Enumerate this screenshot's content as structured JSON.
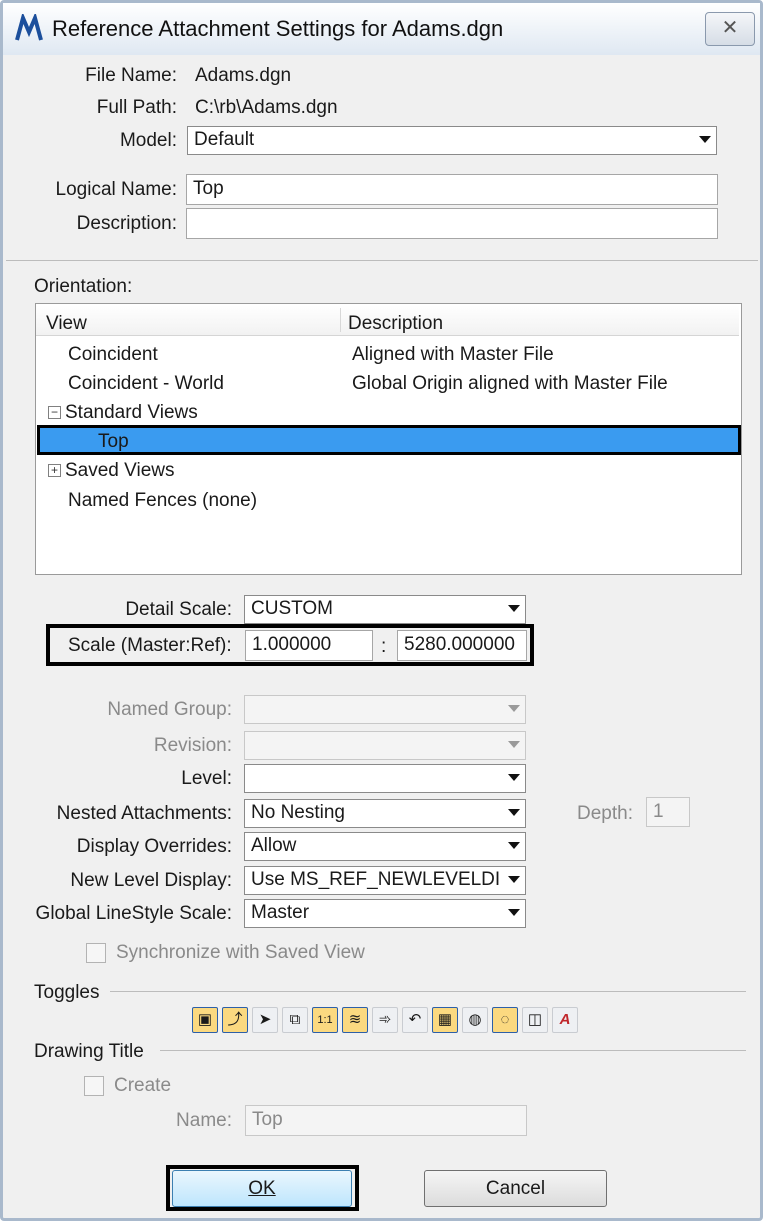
{
  "window": {
    "title": "Reference Attachment Settings for Adams.dgn",
    "close_glyph": "✕"
  },
  "file": {
    "file_name_label": "File Name:",
    "file_name": "Adams.dgn",
    "full_path_label": "Full Path:",
    "full_path": "C:\\rb\\Adams.dgn",
    "model_label": "Model:",
    "model": "Default",
    "logical_name_label": "Logical Name:",
    "logical_name": "Top",
    "description_label": "Description:",
    "description": ""
  },
  "orientation": {
    "label": "Orientation:",
    "columns": {
      "view": "View",
      "description": "Description"
    },
    "rows": [
      {
        "view": "Coincident",
        "description": "Aligned with Master File"
      },
      {
        "view": "Coincident - World",
        "description": "Global Origin aligned with Master File"
      },
      {
        "view": "Standard Views",
        "description": "",
        "expander": "−"
      },
      {
        "view": "Top",
        "description": "",
        "selected": true
      },
      {
        "view": "Saved Views",
        "description": "",
        "expander": "+"
      },
      {
        "view": "Named Fences (none)",
        "description": ""
      }
    ]
  },
  "scale": {
    "detail_scale_label": "Detail Scale:",
    "detail_scale": "CUSTOM",
    "scale_label": "Scale (Master:Ref):",
    "master": "1.000000",
    "separator": ":",
    "ref": "5280.000000"
  },
  "attachment": {
    "named_group_label": "Named Group:",
    "named_group": "",
    "revision_label": "Revision:",
    "revision": "",
    "level_label": "Level:",
    "level": "",
    "nested_label": "Nested Attachments:",
    "nested": "No Nesting",
    "depth_label": "Depth:",
    "depth": "1",
    "display_overrides_label": "Display Overrides:",
    "display_overrides": "Allow",
    "new_level_label": "New Level Display:",
    "new_level": "Use MS_REF_NEWLEVELDI",
    "linestyle_label": "Global LineStyle Scale:",
    "linestyle": "Master",
    "sync_label": "Synchronize with Saved View"
  },
  "toggles": {
    "label": "Toggles",
    "items": [
      {
        "icon": "display-icon",
        "glyph": "▣",
        "on": true
      },
      {
        "icon": "snap-icon",
        "glyph": "⤴",
        "on": true
      },
      {
        "icon": "locate-icon",
        "glyph": "➤",
        "on": false
      },
      {
        "icon": "ignore-attach-icon",
        "glyph": "⧉",
        "on": false
      },
      {
        "icon": "true-scale-icon",
        "glyph": "1:1",
        "on": true
      },
      {
        "icon": "scale-line-styles-icon",
        "glyph": "≋",
        "on": true
      },
      {
        "icon": "treat-as-element-icon",
        "glyph": "➾",
        "on": false
      },
      {
        "icon": "use-lights-icon",
        "glyph": "↶",
        "on": false
      },
      {
        "icon": "hiliting-icon",
        "glyph": "▦",
        "on": true
      },
      {
        "icon": "display-raster-icon",
        "glyph": "◍",
        "on": false
      },
      {
        "icon": "lightbulb-icon",
        "glyph": "◌",
        "on": true
      },
      {
        "icon": "print-icon",
        "glyph": "◫",
        "on": false
      },
      {
        "icon": "annotation-icon",
        "glyph": "A",
        "on": false
      }
    ]
  },
  "drawing_title": {
    "label": "Drawing Title",
    "create_label": "Create",
    "name_label": "Name:",
    "name": "Top"
  },
  "buttons": {
    "ok": "OK",
    "cancel": "Cancel"
  },
  "colors": {
    "selection": "#3a9bf0",
    "toggle_on": "#fbd980"
  }
}
